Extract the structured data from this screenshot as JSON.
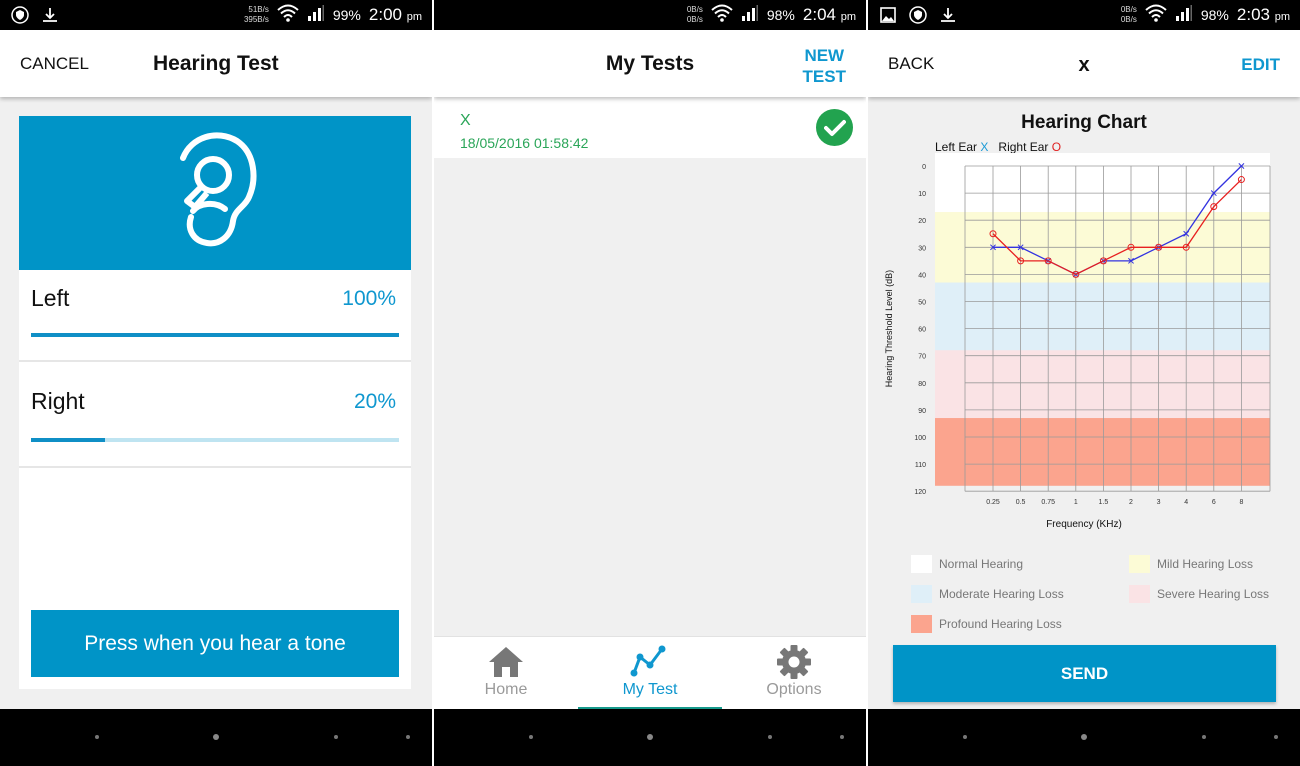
{
  "screens": [
    {
      "status_bar": {
        "speed_up": "51B/s",
        "speed_down": "395B/s",
        "battery": "99%",
        "time": "2:00",
        "ampm": "pm",
        "left_icons": [
          "shield-icon",
          "download-icon"
        ]
      },
      "app_bar": {
        "left_action": "CANCEL",
        "title": "Hearing Test"
      },
      "ears": [
        {
          "label": "Left",
          "progress_text": "100%",
          "progress": 1.0
        },
        {
          "label": "Right",
          "progress_text": "20%",
          "progress": 0.2
        }
      ],
      "tone_button": "Press when you hear a tone",
      "colors": {
        "accent": "#0094c7",
        "track": "#bfe4f1"
      }
    },
    {
      "status_bar": {
        "speed_up": "0B/s",
        "speed_down": "0B/s",
        "battery": "98%",
        "time": "2:04",
        "ampm": "pm"
      },
      "app_bar": {
        "title": "My Tests",
        "right_action_line1": "NEW",
        "right_action_line2": "TEST"
      },
      "tests": [
        {
          "name": "X",
          "date": "18/05/2016 01:58:42",
          "status": "completed"
        }
      ],
      "tabs": [
        {
          "label": "Home",
          "icon": "home-icon",
          "active": false
        },
        {
          "label": "My Test",
          "icon": "chart-line-icon",
          "active": true
        },
        {
          "label": "Options",
          "icon": "gear-icon",
          "active": false
        }
      ],
      "colors": {
        "success": "#22a34f",
        "tab_indicator": "#15998b"
      }
    },
    {
      "status_bar": {
        "speed_up": "0B/s",
        "speed_down": "0B/s",
        "battery": "98%",
        "time": "2:03",
        "ampm": "pm",
        "left_icons": [
          "image-icon",
          "shield-icon",
          "download-icon"
        ]
      },
      "app_bar": {
        "left_action": "BACK",
        "title": "x",
        "right_action": "EDIT"
      },
      "legend_left": "Left Ear",
      "legend_left_mark": "X",
      "legend_right": "Right Ear",
      "legend_right_mark": "O",
      "band_legend": [
        {
          "label": "Normal Hearing",
          "color": "#ffffff"
        },
        {
          "label": "Mild Hearing Loss",
          "color": "#fcfbd6"
        },
        {
          "label": "Moderate Hearing Loss",
          "color": "#dfeff8"
        },
        {
          "label": "Severe Hearing Loss",
          "color": "#fae3e5"
        },
        {
          "label": "Profound Hearing Loss",
          "color": "#fba48e"
        }
      ],
      "send_button": "SEND"
    }
  ],
  "chart_data": {
    "type": "line",
    "title": "Hearing Chart",
    "xlabel": "Frequency (KHz)",
    "ylabel": "Hearing Threshold Level (dB)",
    "categories": [
      "0.25",
      "0.5",
      "0.75",
      "1",
      "1.5",
      "2",
      "3",
      "4",
      "6",
      "8"
    ],
    "y_ticks": [
      0,
      10,
      20,
      30,
      40,
      50,
      60,
      70,
      80,
      90,
      100,
      110,
      120
    ],
    "ylim": [
      0,
      120
    ],
    "y_inverted": true,
    "grid": true,
    "bands": [
      {
        "name": "Normal Hearing",
        "from": -5,
        "to": 17,
        "color": "#ffffff"
      },
      {
        "name": "Mild Hearing Loss",
        "from": 17,
        "to": 43,
        "color": "#fcfbd6"
      },
      {
        "name": "Moderate Hearing Loss",
        "from": 43,
        "to": 68,
        "color": "#dfeff8"
      },
      {
        "name": "Severe Hearing Loss",
        "from": 68,
        "to": 93,
        "color": "#fae3e5"
      },
      {
        "name": "Profound Hearing Loss",
        "from": 93,
        "to": 118,
        "color": "#fba48e"
      }
    ],
    "series": [
      {
        "name": "Left Ear",
        "marker": "x",
        "color": "#3333e0",
        "values": [
          30,
          30,
          35,
          40,
          35,
          35,
          30,
          25,
          10,
          0
        ]
      },
      {
        "name": "Right Ear",
        "marker": "o",
        "color": "#e82020",
        "values": [
          25,
          35,
          35,
          40,
          35,
          30,
          30,
          30,
          15,
          5
        ]
      }
    ]
  }
}
